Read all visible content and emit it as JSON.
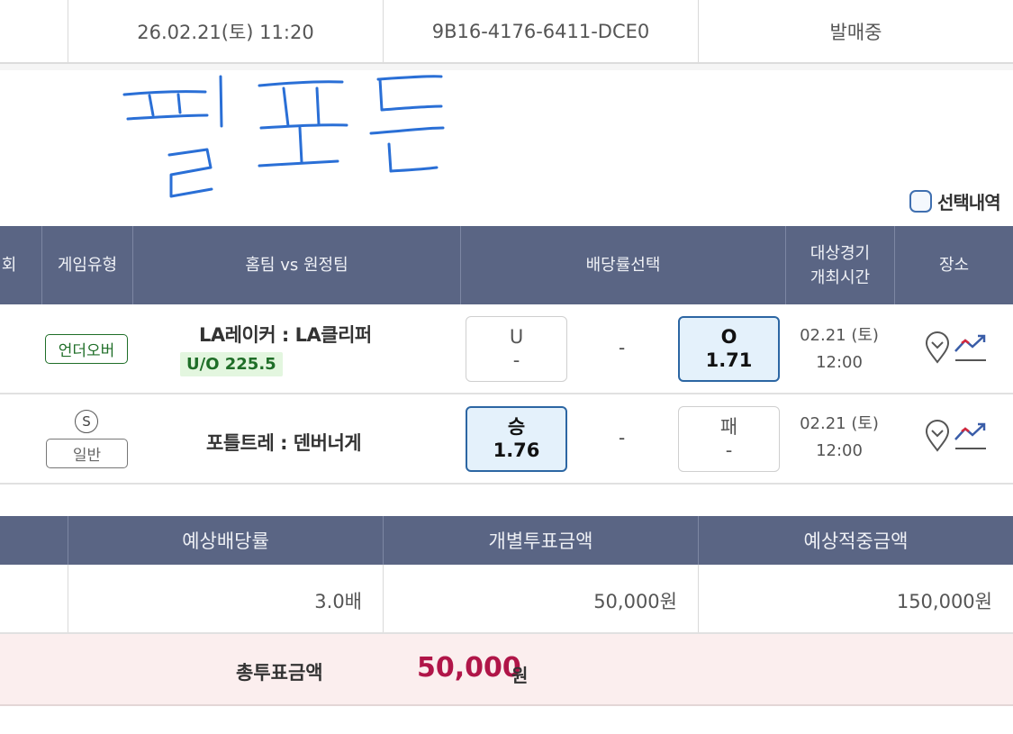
{
  "top_row": {
    "date": "26.02.21(토) 11:20",
    "slip_id": "9B16-4176-6411-DCE0",
    "status": "발매중"
  },
  "selected_history": {
    "label": "선택내역"
  },
  "game_table": {
    "headers": {
      "round": "회",
      "game_type": "게임유형",
      "teams": "홈팀 vs 원정팀",
      "odds_select": "배당률선택",
      "match_time_line1": "대상경기",
      "match_time_line2": "개최시간",
      "place": "장소"
    },
    "rows": [
      {
        "type_label": "언더오버",
        "teams": "LA레이커 : LA클리퍼",
        "badge": "U/O 225.5",
        "left_label": "U",
        "left_value": "-",
        "middle": "-",
        "right_label": "O",
        "right_value": "1.71",
        "selected": "right",
        "date": "02.21 (토)",
        "time": "12:00"
      },
      {
        "type_icon_letter": "S",
        "type_label": "일반",
        "teams": "포틀트레 : 덴버너게",
        "left_label": "승",
        "left_value": "1.76",
        "middle": "-",
        "right_label": "패",
        "right_value": "-",
        "selected": "left",
        "date": "02.21 (토)",
        "time": "12:00"
      }
    ]
  },
  "summary": {
    "headers": {
      "expected_odds": "예상배당률",
      "individual_amount": "개별투표금액",
      "expected_win": "예상적중금액"
    },
    "values": {
      "expected_odds": "3.0배",
      "individual_amount": "50,000원",
      "expected_win": "150,000원"
    },
    "total": {
      "label": "총투표금액",
      "amount": "50,000",
      "unit": "원"
    }
  },
  "colors": {
    "header_bg": "#5a6584",
    "accent_blue": "#2c66a3",
    "total_red": "#b01548",
    "handwriting": "#2a6fd6"
  }
}
